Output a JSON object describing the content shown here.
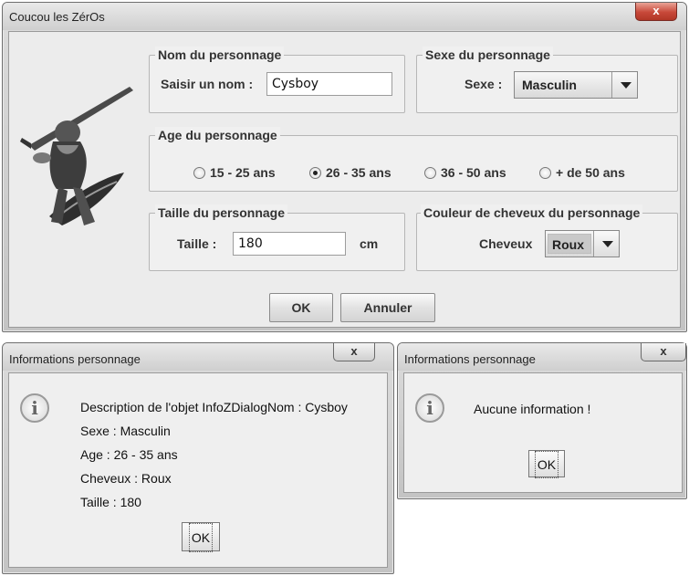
{
  "main_window": {
    "title": "Coucou les ZérOs",
    "close_label": "x",
    "name_group": {
      "legend": "Nom du personnage",
      "label": "Saisir un nom :",
      "value": "Cysboy"
    },
    "sex_group": {
      "legend": "Sexe du personnage",
      "label": "Sexe :",
      "selected": "Masculin"
    },
    "age_group": {
      "legend": "Age du personnage",
      "options": [
        "15 - 25 ans",
        "26 - 35 ans",
        "36 - 50 ans",
        "+ de 50 ans"
      ],
      "selected_index": 1
    },
    "size_group": {
      "legend": "Taille du personnage",
      "label": "Taille :",
      "value": "180",
      "unit": "cm"
    },
    "hair_group": {
      "legend": "Couleur de cheveux du personnage",
      "label": "Cheveux",
      "selected": "Roux"
    },
    "ok_label": "OK",
    "cancel_label": "Annuler"
  },
  "info_dialog": {
    "title": "Informations personnage",
    "close_label": "x",
    "icon": "info-icon",
    "lines": [
      "Description de l'objet InfoZDialogNom : Cysboy",
      "Sexe : Masculin",
      "Age : 26 - 35 ans",
      "Cheveux : Roux",
      "Taille : 180"
    ],
    "ok_label": "OK"
  },
  "empty_dialog": {
    "title": "Informations personnage",
    "close_label": "x",
    "icon": "info-icon",
    "message": "Aucune information !",
    "ok_label": "OK"
  }
}
